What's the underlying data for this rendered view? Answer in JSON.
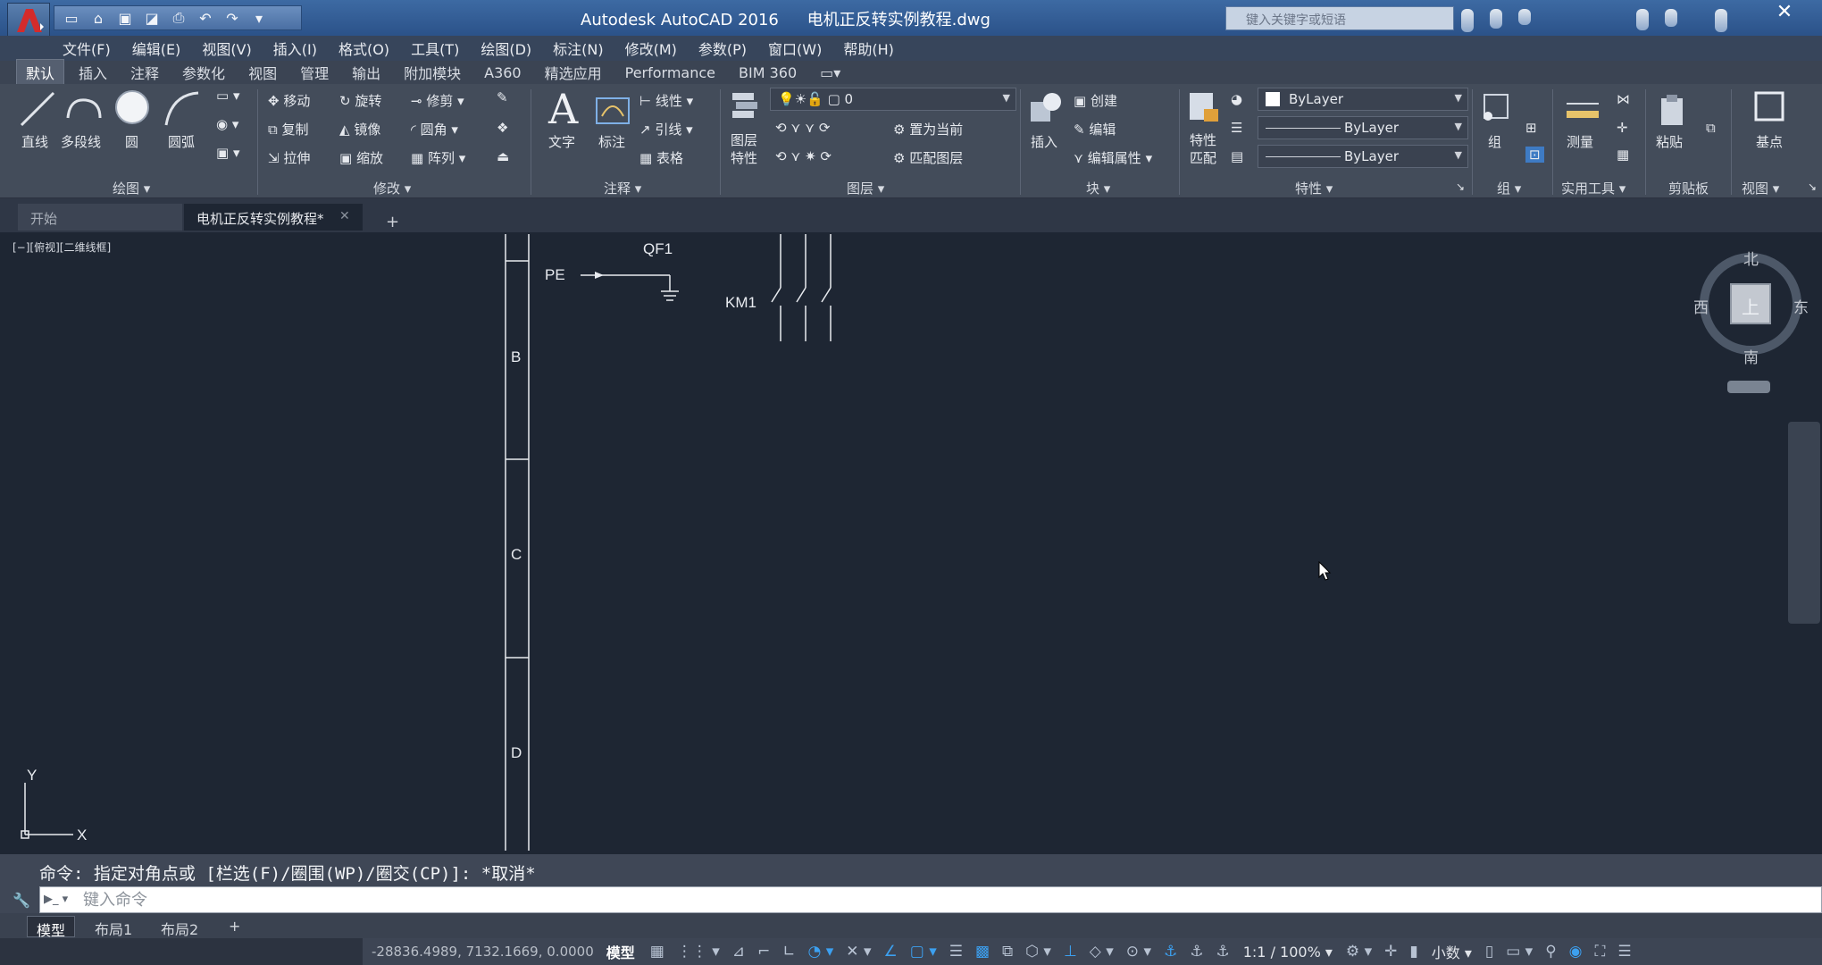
{
  "window": {
    "app_name": "Autodesk AutoCAD 2016",
    "file_name": "电机正反转实例教程.dwg",
    "search_placeholder": "键入关键字或短语",
    "close_symbol": "✕"
  },
  "quick_access": [
    "new-icon",
    "open-icon",
    "save-icon",
    "save-as-icon",
    "print-icon",
    "undo-icon",
    "redo-icon",
    "customize-icon"
  ],
  "menu": [
    "文件(F)",
    "编辑(E)",
    "视图(V)",
    "插入(I)",
    "格式(O)",
    "工具(T)",
    "绘图(D)",
    "标注(N)",
    "修改(M)",
    "参数(P)",
    "窗口(W)",
    "帮助(H)"
  ],
  "ribbon_tabs": [
    "默认",
    "插入",
    "注释",
    "参数化",
    "视图",
    "管理",
    "输出",
    "附加模块",
    "A360",
    "精选应用",
    "Performance",
    "BIM 360"
  ],
  "ribbon": {
    "draw": {
      "title": "绘图",
      "line": "直线",
      "polyline": "多段线",
      "circle": "圆",
      "arc": "圆弧"
    },
    "modify": {
      "title": "修改",
      "move": "移动",
      "rotate": "旋转",
      "trim": "修剪",
      "copy": "复制",
      "mirror": "镜像",
      "fillet": "圆角",
      "stretch": "拉伸",
      "scale": "缩放",
      "array": "阵列"
    },
    "annotation": {
      "title": "注释",
      "text": "文字",
      "dimension": "标注",
      "linear": "线性",
      "leader": "引线",
      "table": "表格"
    },
    "layers": {
      "title": "图层",
      "layer_properties_1": "图层",
      "layer_properties_2": "特性",
      "current_layer": "0",
      "set_current": "置为当前",
      "match_layer": "匹配图层"
    },
    "block": {
      "title": "块",
      "insert": "插入",
      "create": "创建",
      "edit": "编辑",
      "edit_attributes": "编辑属性"
    },
    "properties": {
      "title": "特性",
      "match_1": "特性",
      "match_2": "匹配",
      "color": "ByLayer",
      "linetype": "ByLayer",
      "lineweight": "ByLayer"
    },
    "groups": {
      "title": "组",
      "group": "组"
    },
    "utilities": {
      "title": "实用工具",
      "measure": "测量"
    },
    "clipboard": {
      "title": "剪贴板",
      "paste": "粘贴"
    },
    "view": {
      "title": "视图",
      "base": "基点"
    }
  },
  "file_tabs": {
    "start": "开始",
    "current": "电机正反转实例教程*",
    "add": "+"
  },
  "viewport_label": "[−][俯视][二维线框]",
  "drawing": {
    "zone_labels": [
      "B",
      "C",
      "D"
    ],
    "pe_label": "PE",
    "qf_label": "QF1",
    "km_label": "KM1",
    "ucs_x": "X",
    "ucs_y": "Y"
  },
  "viewcube": {
    "north": "北",
    "south": "南",
    "east": "东",
    "west": "西",
    "top": "上"
  },
  "command": {
    "history": "命令: 指定对角点或 [栏选(F)/圈围(WP)/圈交(CP)]: *取消*",
    "placeholder": "键入命令"
  },
  "layout_tabs": [
    "模型",
    "布局1",
    "布局2"
  ],
  "layout_add": "+",
  "status": {
    "coords": "-28836.4989, 7132.1669, 0.0000",
    "model": "模型",
    "scale": "1:1 / 100%",
    "units": "小数"
  }
}
